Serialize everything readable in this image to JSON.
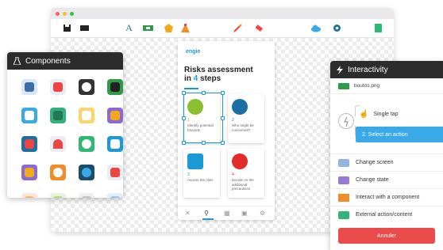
{
  "components": {
    "title": "Components"
  },
  "interactivity": {
    "title": "Interactivity",
    "file": "boutos.png",
    "trigger": "Single tap",
    "select": "2. Select an action",
    "actions": [
      "Change screen",
      "Change state",
      "Interact with a component",
      "External action/content"
    ],
    "cancel": "Annuler"
  },
  "phone": {
    "brand": "engie",
    "title_part1": "Risks assessment",
    "title_part2_prefix": "in",
    "title_number": "4",
    "title_part2_suffix": "steps",
    "cards": [
      {
        "num": "1",
        "text": "Identify potential hazards",
        "color": "#8cbf2f",
        "numcolor": "#e8a21e"
      },
      {
        "num": "2",
        "text": "Who might be concerned?",
        "color": "#1c6fa5",
        "numcolor": "#1c6fa5"
      },
      {
        "num": "3",
        "text": "Assess the risks",
        "color": "#1c9ad6",
        "numcolor": "#1c9ad6"
      },
      {
        "num": "4",
        "text": "Decide on the additional precautions",
        "color": "#e22b2b",
        "numcolor": "#e22b2b"
      }
    ]
  },
  "colors": {
    "accent": "#1c9ad6",
    "select_bg": "#3aa9e8",
    "cancel": "#e94b4b",
    "panel_header": "#2c2c2c"
  }
}
